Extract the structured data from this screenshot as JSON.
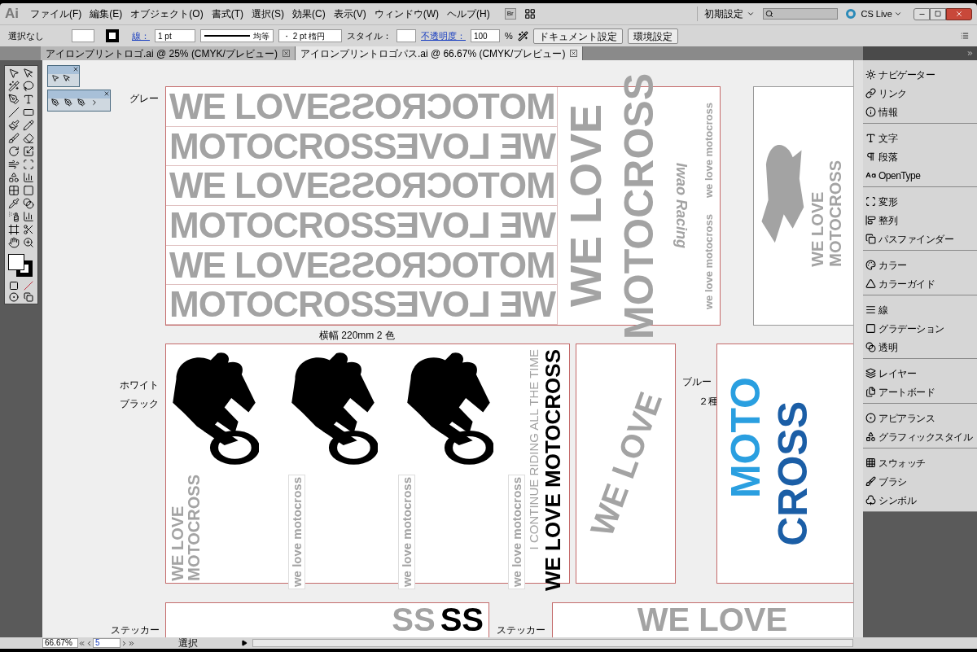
{
  "app": {
    "logo": "Ai",
    "menus": [
      "ファイル(F)",
      "編集(E)",
      "オブジェクト(O)",
      "書式(T)",
      "選択(S)",
      "効果(C)",
      "表示(V)",
      "ウィンドウ(W)",
      "ヘルプ(H)"
    ],
    "bridge": "Br",
    "workspace": "初期設定",
    "cs_live": "CS Live"
  },
  "control_bar": {
    "selection": "選択なし",
    "stroke_label": "線：",
    "stroke_weight": "1 pt",
    "stroke_profile": "均等",
    "brush": "・ 2 pt 楕円",
    "style_label": "スタイル：",
    "opacity_label": "不透明度：",
    "opacity": "100",
    "percent": "%",
    "buttons": [
      "ドキュメント設定",
      "環境設定"
    ]
  },
  "tabs": [
    {
      "label": "アイロンプリントロゴ.ai @ 25% (CMYK/プレビュー)",
      "selected": false
    },
    {
      "label": "アイロンプリントロゴパス.ai @ 66.67% (CMYK/プレビュー)",
      "selected": true
    }
  ],
  "canvas": {
    "grey": {
      "label": "グレー",
      "caption": "横幅 220mm 2 色",
      "rows": [
        {
          "left": "WE LOVE",
          "right": "MOTOCROSS"
        },
        {
          "left": "MOTOCROSS",
          "right": "WE LOVE"
        },
        {
          "left": "WE LOVE",
          "right": "MOTOCROSS"
        },
        {
          "left": "MOTOCROSS",
          "right": "WE LOVE"
        },
        {
          "left": "WE LOVE",
          "right": "MOTOCROSS"
        },
        {
          "left": "MOTOCROSS",
          "right": "WE LOVE"
        }
      ],
      "columns": [
        "WE LOVE",
        "MOTOCROSS",
        "Iwao Racing"
      ],
      "badges": [
        "we love motocross",
        "we love motocross"
      ],
      "side": [
        "WE LOVE",
        "MOTOCROSS"
      ]
    },
    "mono": {
      "labels": [
        "ホワイト",
        "ブラック"
      ],
      "small": [
        "WE LOVE",
        "MOTOCROSS"
      ],
      "badges": [
        "we love motocross",
        "we love motocross",
        "we love motocross"
      ],
      "tagline": "I CONTINUE RIDING ALL THE TIME",
      "title": "WE LOVE MOTOCROSS"
    },
    "arc": {
      "text": "WE LOVE"
    },
    "blue": {
      "labels": [
        "ブルー",
        "２種"
      ],
      "words": [
        {
          "text": "MOTO",
          "color": "#2a9fe0"
        },
        {
          "text": "CROSS",
          "color": "#1b5ea6"
        }
      ]
    },
    "stickers": [
      {
        "label": "ステッカー",
        "texts": [
          "SS",
          "SS"
        ]
      },
      {
        "label": "ステッカー",
        "texts": [
          "WE LOVE"
        ]
      }
    ]
  },
  "panels": [
    [
      {
        "label": "ナビゲーター"
      },
      {
        "label": "リンク"
      },
      {
        "label": "情報"
      }
    ],
    [
      {
        "label": "文字"
      },
      {
        "label": "段落"
      },
      {
        "label": "OpenType"
      }
    ],
    [
      {
        "label": "変形"
      },
      {
        "label": "整列"
      },
      {
        "label": "パスファインダー"
      }
    ],
    [
      {
        "label": "カラー"
      },
      {
        "label": "カラーガイド"
      }
    ],
    [
      {
        "label": "線"
      },
      {
        "label": "グラデーション"
      },
      {
        "label": "透明"
      }
    ],
    [
      {
        "label": "レイヤー"
      },
      {
        "label": "アートボード"
      }
    ],
    [
      {
        "label": "アピアランス"
      },
      {
        "label": "グラフィックスタイル"
      }
    ],
    [
      {
        "label": "スウォッチ"
      },
      {
        "label": "ブラシ"
      },
      {
        "label": "シンボル"
      }
    ]
  ],
  "status_bar": {
    "zoom": "66.67%",
    "artboard": "5",
    "tool": "選択"
  }
}
